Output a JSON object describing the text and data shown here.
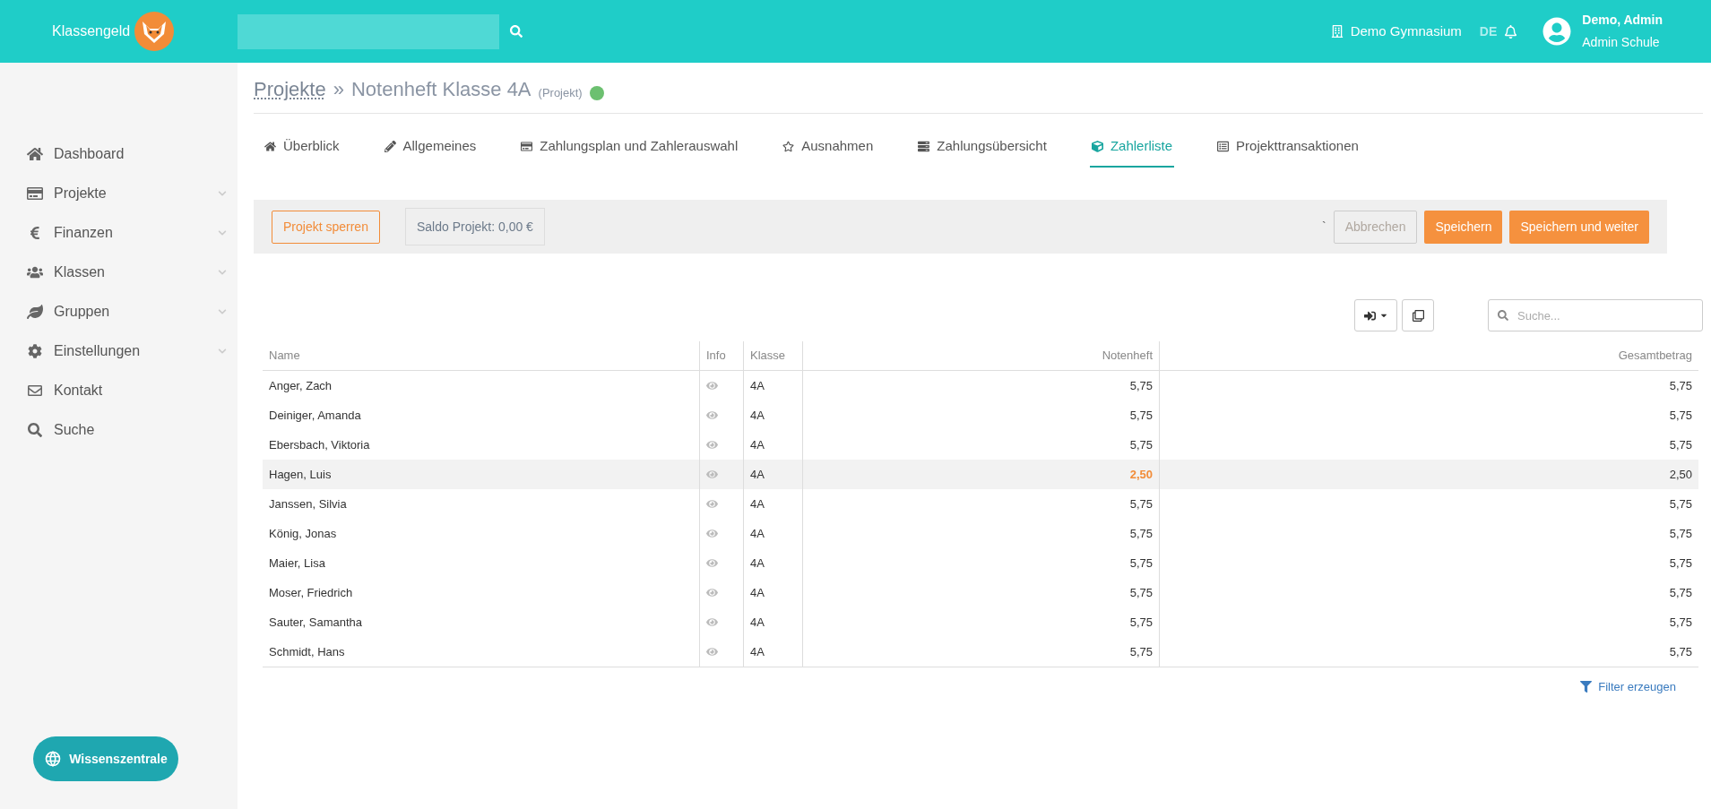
{
  "header": {
    "brand": "Klassengeld",
    "school": "Demo Gymnasium",
    "language": {
      "label": "DE",
      "selected": false
    },
    "user_name": "Demo, Admin",
    "user_role": "Admin Schule"
  },
  "sidebar": {
    "items": [
      {
        "label": "Dashboard",
        "expandable": false
      },
      {
        "label": "Projekte",
        "expandable": true
      },
      {
        "label": "Finanzen",
        "expandable": true
      },
      {
        "label": "Klassen",
        "expandable": true
      },
      {
        "label": "Gruppen",
        "expandable": true
      },
      {
        "label": "Einstellungen",
        "expandable": true
      },
      {
        "label": "Kontakt",
        "expandable": false
      },
      {
        "label": "Suche",
        "expandable": false
      }
    ],
    "help_button": "Wissenszentrale"
  },
  "breadcrumb": {
    "parent": "Projekte",
    "separator": "»",
    "title": "Notenheft Klasse 4A",
    "type": "(Projekt)",
    "color": "#6cc070"
  },
  "tabs": [
    {
      "label": "Überblick",
      "selected": false
    },
    {
      "label": "Allgemeines",
      "selected": false
    },
    {
      "label": "Zahlungsplan und Zahlerauswahl",
      "selected": false
    },
    {
      "label": "Ausnahmen",
      "selected": false
    },
    {
      "label": "Zahlungsübersicht",
      "selected": false
    },
    {
      "label": "Zahlerliste",
      "selected": true
    },
    {
      "label": "Projekttransaktionen",
      "selected": false
    }
  ],
  "action_bar": {
    "lock_button": "Projekt sperren",
    "balance": "Saldo Projekt: 0,00 €",
    "stray_mark": "`",
    "cancel_button": "Abbrechen",
    "save_button": "Speichern",
    "save_next_button": "Speichern und weiter"
  },
  "table": {
    "search_placeholder": "Suche...",
    "columns": [
      "Name",
      "Info",
      "Klasse",
      "Notenheft",
      "Gesamtbetrag"
    ],
    "rows": [
      {
        "name": "Anger, Zach",
        "klasse": "4A",
        "notenheft": "5,75",
        "gesamt": "5,75",
        "selected": false,
        "changed": false
      },
      {
        "name": "Deiniger, Amanda",
        "klasse": "4A",
        "notenheft": "5,75",
        "gesamt": "5,75",
        "selected": false,
        "changed": false
      },
      {
        "name": "Ebersbach, Viktoria",
        "klasse": "4A",
        "notenheft": "5,75",
        "gesamt": "5,75",
        "selected": false,
        "changed": false
      },
      {
        "name": "Hagen, Luis",
        "klasse": "4A",
        "notenheft": "2,50",
        "gesamt": "2,50",
        "selected": true,
        "changed": true
      },
      {
        "name": "Janssen, Silvia",
        "klasse": "4A",
        "notenheft": "5,75",
        "gesamt": "5,75",
        "selected": false,
        "changed": false
      },
      {
        "name": "König, Jonas",
        "klasse": "4A",
        "notenheft": "5,75",
        "gesamt": "5,75",
        "selected": false,
        "changed": false
      },
      {
        "name": "Maier, Lisa",
        "klasse": "4A",
        "notenheft": "5,75",
        "gesamt": "5,75",
        "selected": false,
        "changed": false
      },
      {
        "name": "Moser, Friedrich",
        "klasse": "4A",
        "notenheft": "5,75",
        "gesamt": "5,75",
        "selected": false,
        "changed": false
      },
      {
        "name": "Sauter, Samantha",
        "klasse": "4A",
        "notenheft": "5,75",
        "gesamt": "5,75",
        "selected": false,
        "changed": false
      },
      {
        "name": "Schmidt, Hans",
        "klasse": "4A",
        "notenheft": "5,75",
        "gesamt": "5,75",
        "selected": false,
        "changed": false
      }
    ],
    "filter_link": "Filter erzeugen"
  }
}
